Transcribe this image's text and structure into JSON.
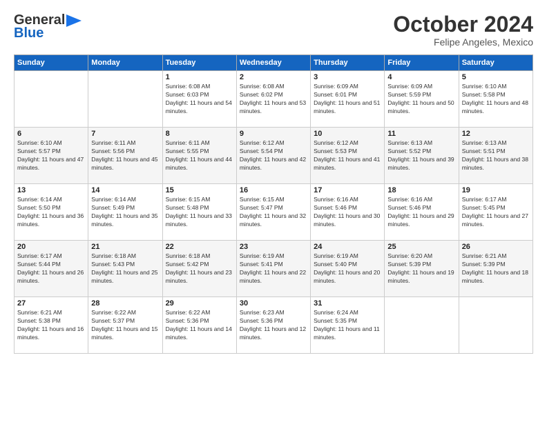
{
  "logo": {
    "general": "General",
    "blue": "Blue"
  },
  "header": {
    "month": "October 2024",
    "location": "Felipe Angeles, Mexico"
  },
  "days_of_week": [
    "Sunday",
    "Monday",
    "Tuesday",
    "Wednesday",
    "Thursday",
    "Friday",
    "Saturday"
  ],
  "weeks": [
    [
      {
        "day": "",
        "info": ""
      },
      {
        "day": "",
        "info": ""
      },
      {
        "day": "1",
        "info": "Sunrise: 6:08 AM\nSunset: 6:03 PM\nDaylight: 11 hours and 54 minutes."
      },
      {
        "day": "2",
        "info": "Sunrise: 6:08 AM\nSunset: 6:02 PM\nDaylight: 11 hours and 53 minutes."
      },
      {
        "day": "3",
        "info": "Sunrise: 6:09 AM\nSunset: 6:01 PM\nDaylight: 11 hours and 51 minutes."
      },
      {
        "day": "4",
        "info": "Sunrise: 6:09 AM\nSunset: 5:59 PM\nDaylight: 11 hours and 50 minutes."
      },
      {
        "day": "5",
        "info": "Sunrise: 6:10 AM\nSunset: 5:58 PM\nDaylight: 11 hours and 48 minutes."
      }
    ],
    [
      {
        "day": "6",
        "info": "Sunrise: 6:10 AM\nSunset: 5:57 PM\nDaylight: 11 hours and 47 minutes."
      },
      {
        "day": "7",
        "info": "Sunrise: 6:11 AM\nSunset: 5:56 PM\nDaylight: 11 hours and 45 minutes."
      },
      {
        "day": "8",
        "info": "Sunrise: 6:11 AM\nSunset: 5:55 PM\nDaylight: 11 hours and 44 minutes."
      },
      {
        "day": "9",
        "info": "Sunrise: 6:12 AM\nSunset: 5:54 PM\nDaylight: 11 hours and 42 minutes."
      },
      {
        "day": "10",
        "info": "Sunrise: 6:12 AM\nSunset: 5:53 PM\nDaylight: 11 hours and 41 minutes."
      },
      {
        "day": "11",
        "info": "Sunrise: 6:13 AM\nSunset: 5:52 PM\nDaylight: 11 hours and 39 minutes."
      },
      {
        "day": "12",
        "info": "Sunrise: 6:13 AM\nSunset: 5:51 PM\nDaylight: 11 hours and 38 minutes."
      }
    ],
    [
      {
        "day": "13",
        "info": "Sunrise: 6:14 AM\nSunset: 5:50 PM\nDaylight: 11 hours and 36 minutes."
      },
      {
        "day": "14",
        "info": "Sunrise: 6:14 AM\nSunset: 5:49 PM\nDaylight: 11 hours and 35 minutes."
      },
      {
        "day": "15",
        "info": "Sunrise: 6:15 AM\nSunset: 5:48 PM\nDaylight: 11 hours and 33 minutes."
      },
      {
        "day": "16",
        "info": "Sunrise: 6:15 AM\nSunset: 5:47 PM\nDaylight: 11 hours and 32 minutes."
      },
      {
        "day": "17",
        "info": "Sunrise: 6:16 AM\nSunset: 5:46 PM\nDaylight: 11 hours and 30 minutes."
      },
      {
        "day": "18",
        "info": "Sunrise: 6:16 AM\nSunset: 5:46 PM\nDaylight: 11 hours and 29 minutes."
      },
      {
        "day": "19",
        "info": "Sunrise: 6:17 AM\nSunset: 5:45 PM\nDaylight: 11 hours and 27 minutes."
      }
    ],
    [
      {
        "day": "20",
        "info": "Sunrise: 6:17 AM\nSunset: 5:44 PM\nDaylight: 11 hours and 26 minutes."
      },
      {
        "day": "21",
        "info": "Sunrise: 6:18 AM\nSunset: 5:43 PM\nDaylight: 11 hours and 25 minutes."
      },
      {
        "day": "22",
        "info": "Sunrise: 6:18 AM\nSunset: 5:42 PM\nDaylight: 11 hours and 23 minutes."
      },
      {
        "day": "23",
        "info": "Sunrise: 6:19 AM\nSunset: 5:41 PM\nDaylight: 11 hours and 22 minutes."
      },
      {
        "day": "24",
        "info": "Sunrise: 6:19 AM\nSunset: 5:40 PM\nDaylight: 11 hours and 20 minutes."
      },
      {
        "day": "25",
        "info": "Sunrise: 6:20 AM\nSunset: 5:39 PM\nDaylight: 11 hours and 19 minutes."
      },
      {
        "day": "26",
        "info": "Sunrise: 6:21 AM\nSunset: 5:39 PM\nDaylight: 11 hours and 18 minutes."
      }
    ],
    [
      {
        "day": "27",
        "info": "Sunrise: 6:21 AM\nSunset: 5:38 PM\nDaylight: 11 hours and 16 minutes."
      },
      {
        "day": "28",
        "info": "Sunrise: 6:22 AM\nSunset: 5:37 PM\nDaylight: 11 hours and 15 minutes."
      },
      {
        "day": "29",
        "info": "Sunrise: 6:22 AM\nSunset: 5:36 PM\nDaylight: 11 hours and 14 minutes."
      },
      {
        "day": "30",
        "info": "Sunrise: 6:23 AM\nSunset: 5:36 PM\nDaylight: 11 hours and 12 minutes."
      },
      {
        "day": "31",
        "info": "Sunrise: 6:24 AM\nSunset: 5:35 PM\nDaylight: 11 hours and 11 minutes."
      },
      {
        "day": "",
        "info": ""
      },
      {
        "day": "",
        "info": ""
      }
    ]
  ]
}
